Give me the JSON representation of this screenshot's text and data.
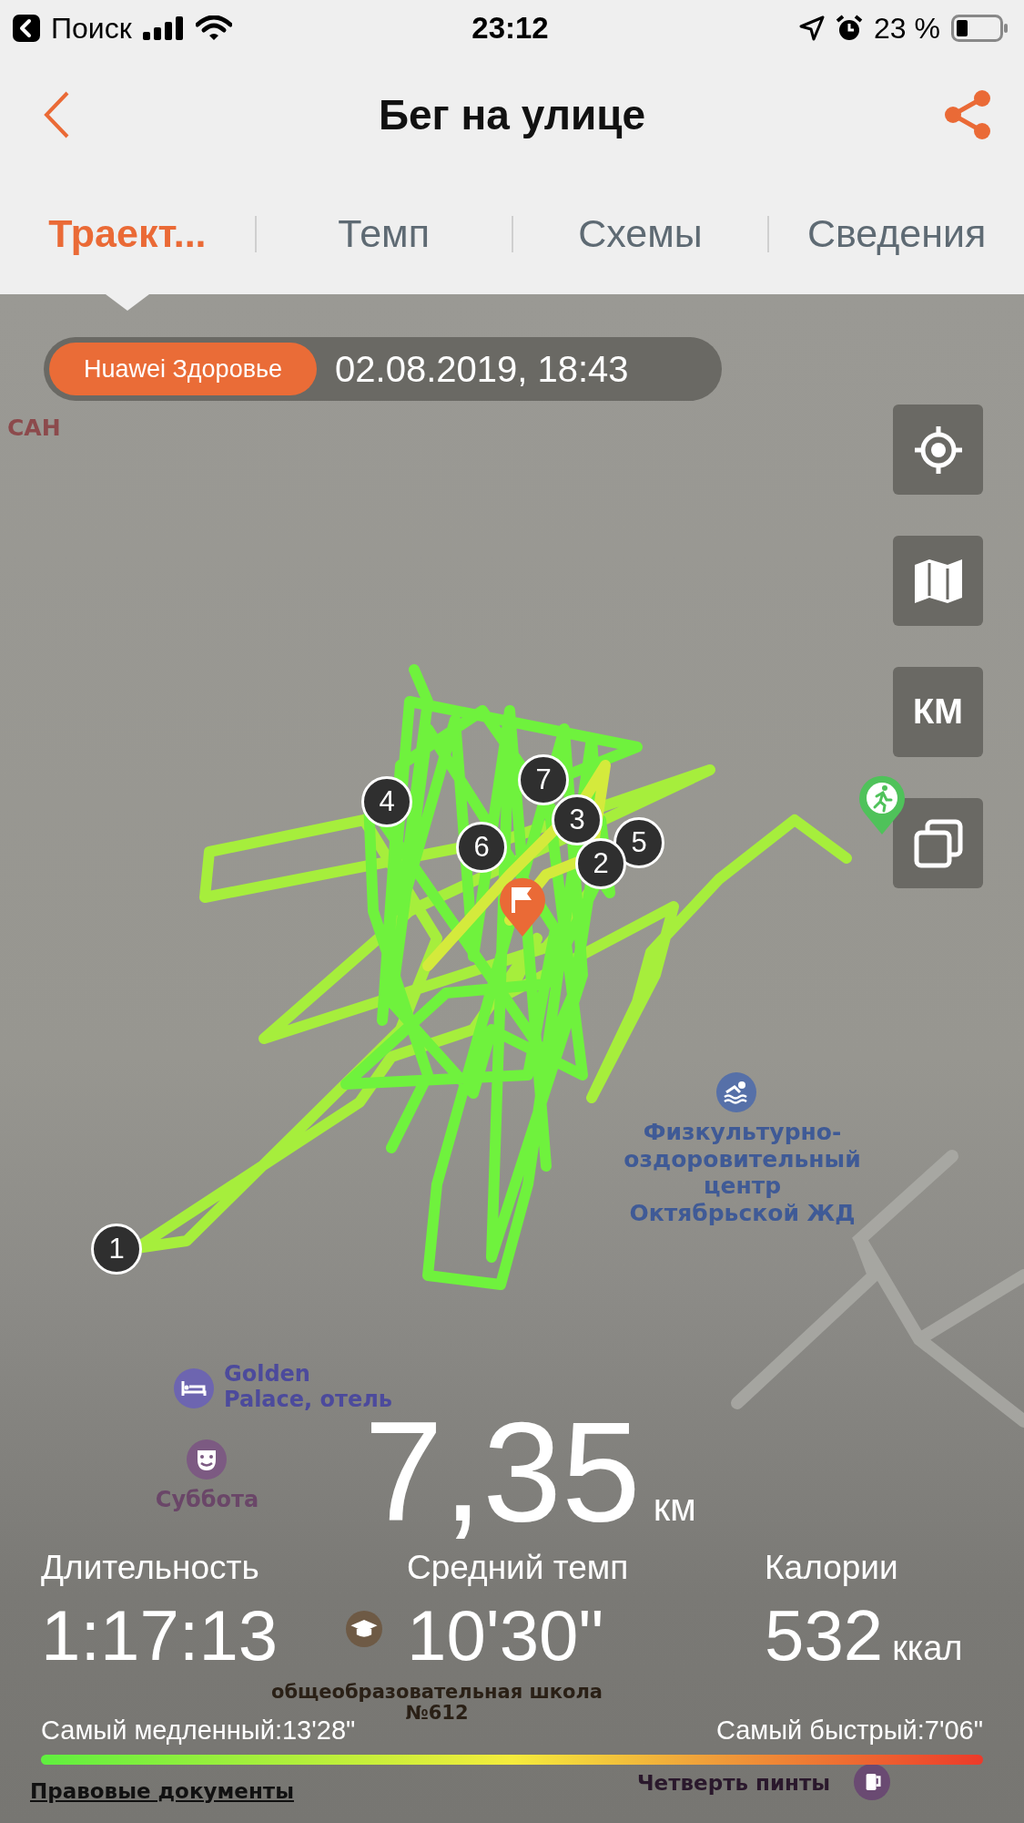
{
  "status_bar": {
    "back_app": "Поиск",
    "time": "23:12",
    "battery": "23 %"
  },
  "header": {
    "title": "Бег на улице"
  },
  "tabs": [
    {
      "label": "Траект...",
      "selected": true
    },
    {
      "label": "Темп",
      "selected": false
    },
    {
      "label": "Схемы",
      "selected": false
    },
    {
      "label": "Сведения",
      "selected": false
    }
  ],
  "map": {
    "source_badge": "Huawei Здоровье",
    "date": "02.08.2019, 18:43",
    "controls": [
      {
        "kind": "locate"
      },
      {
        "kind": "map"
      },
      {
        "kind": "units",
        "label": "КМ"
      },
      {
        "kind": "layers"
      }
    ],
    "labels": [
      {
        "kind": "district",
        "text": "САН"
      },
      {
        "kind": "pool",
        "text": "Физкультурно-оздоровительный центр Октябрьской ЖД"
      },
      {
        "kind": "hotel",
        "text": "Golden Palace, отель"
      },
      {
        "kind": "theatre",
        "text": "Суббота"
      },
      {
        "kind": "school",
        "text": "общеобразовательная школа №612"
      },
      {
        "kind": "pub",
        "text": "Четверть пинты"
      }
    ],
    "markers": [
      {
        "label": "1"
      },
      {
        "label": "2"
      },
      {
        "label": "3"
      },
      {
        "label": "4"
      },
      {
        "label": "5"
      },
      {
        "label": "6"
      },
      {
        "label": "7"
      }
    ]
  },
  "summary": {
    "distance": "7,35",
    "distance_unit": "км",
    "stats": [
      {
        "label": "Длительность",
        "value": "1:17:13"
      },
      {
        "label": "Средний темп",
        "value": "10'30\""
      },
      {
        "label": "Калории",
        "value": "532",
        "unit": "ккал"
      }
    ],
    "slowest": "Самый медленный:13'28\"",
    "fastest": "Самый быстрый:7'06\""
  },
  "footer_link": "Правовые документы"
}
